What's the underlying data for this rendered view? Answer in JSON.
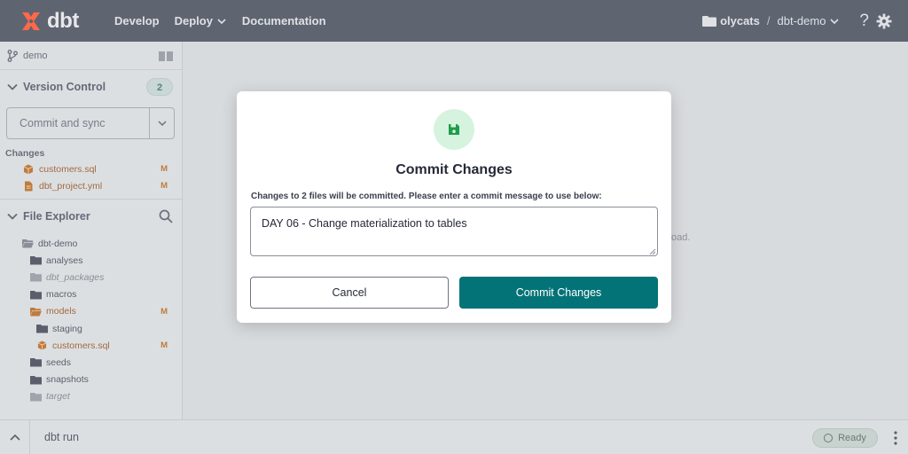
{
  "colors": {
    "nav_bg": "#5f6471",
    "primary": "#047377",
    "modified": "#c07b3e",
    "icon_circle": "#d6f3df",
    "icon_green": "#1e9e4a"
  },
  "topnav": {
    "logo_text": "dbt",
    "links": [
      "Develop",
      "Deploy",
      "Documentation"
    ],
    "org": "olycats",
    "project": "dbt-demo",
    "help": "?"
  },
  "sidebar": {
    "branch": "demo",
    "version_control": {
      "title": "Version Control",
      "badge": "2",
      "action_label": "Commit and sync",
      "changes_title": "Changes",
      "changes": [
        {
          "name": "customers.sql",
          "status": "M",
          "icon": "cube-icon"
        },
        {
          "name": "dbt_project.yml",
          "status": "M",
          "icon": "file-icon"
        }
      ]
    },
    "file_explorer": {
      "title": "File Explorer",
      "tree": [
        {
          "name": "dbt-demo",
          "icon": "folder-open-icon",
          "status": ""
        },
        {
          "name": "analyses",
          "icon": "folder-icon",
          "status": ""
        },
        {
          "name": "dbt_packages",
          "icon": "folder-icon",
          "status": ""
        },
        {
          "name": "macros",
          "icon": "folder-icon",
          "status": ""
        },
        {
          "name": "models",
          "icon": "folder-open-icon",
          "status": "M"
        },
        {
          "name": "staging",
          "icon": "folder-icon",
          "status": ""
        },
        {
          "name": "customers.sql",
          "icon": "cube-icon",
          "status": "M"
        },
        {
          "name": "seeds",
          "icon": "folder-icon",
          "status": ""
        },
        {
          "name": "snapshots",
          "icon": "folder-icon",
          "status": ""
        },
        {
          "name": "target",
          "icon": "folder-icon",
          "status": ""
        }
      ]
    }
  },
  "main": {
    "hint_fragment": "oad."
  },
  "bottombar": {
    "command": "dbt run",
    "status": "Ready"
  },
  "modal": {
    "title": "Commit Changes",
    "description": "Changes to 2 files will be committed. Please enter a commit message to use below:",
    "message_value": "DAY 06 - Change materialization to tables",
    "cancel_label": "Cancel",
    "commit_label": "Commit Changes"
  }
}
